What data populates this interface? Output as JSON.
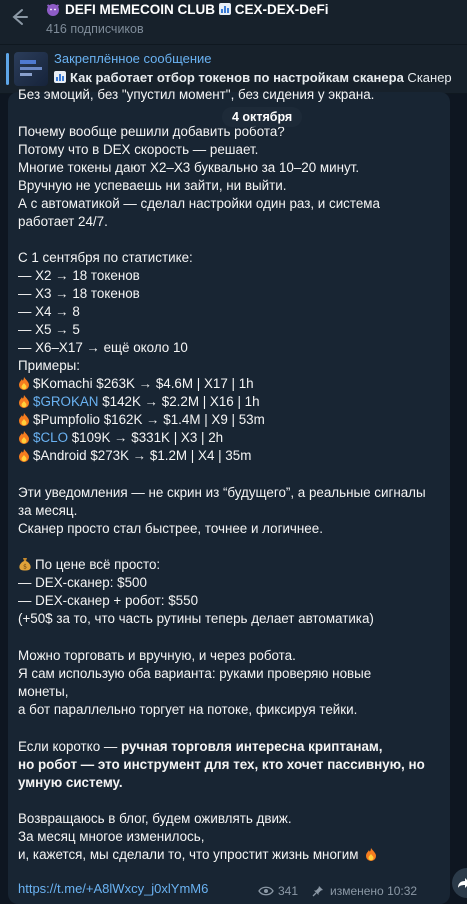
{
  "header": {
    "back_icon": "arrow-left-icon",
    "title_prefix_emoji": "purple-devil-emoji",
    "title": "DEFI MEMECOIN CLUB",
    "title_chart_emoji": "bar-chart-emoji",
    "title_suffix": "CEX-DEX-DeFi",
    "subtitle": "416 подписчиков"
  },
  "pinned": {
    "label": "Закреплённое сообщение",
    "bold_text": "Как работает отбор токенов по настройкам сканера",
    "rest_text": " Сканер"
  },
  "date_pill": "4 октября",
  "message": {
    "line_01": "Без эмоций, без \"упустил момент\", без сидения у экрана.",
    "line_02": "Почему вообще решили добавить робота?",
    "line_03": "Потому что в DEX скорость — решает.",
    "line_04": "Многие токены дают X2–X3 буквально за 10–20 минут.",
    "line_05": "Вручную не успеваешь ни зайти, ни выйти.",
    "line_06": "А с автоматикой — сделал настройки один раз, и система",
    "line_07": "работает 24/7.",
    "line_08": "С 1 сентября по статистике:",
    "line_09": "— X2 → 18 токенов",
    "line_10": "— X3 → 18 токенов",
    "line_11": "— X4 → 8",
    "line_12": "— X5 → 5",
    "line_13": "— X6–X17 → ещё около 10",
    "line_14": "Примеры:",
    "ex_1": "$Komachi $263K → $4.6M | X17 | 1h",
    "ex_2_link": "$GROKAN",
    "ex_2_rest": " $142K → $2.2M | X16 | 1h",
    "ex_3": "$Pumpfolio $162K → $1.4M | X9 | 53m",
    "ex_4_link": "$CLO",
    "ex_4_rest": " $109K → $331K | X3 | 2h",
    "ex_5": "$Android $273K → $1.2M | X4 | 35m",
    "line_15": "Эти уведомления — не скрин из “будущего”, а реальные сигналы",
    "line_16": "за месяц.",
    "line_17": "Сканер просто стал быстрее, точнее и логичнее.",
    "line_18": "По цене всё просто:",
    "line_19": "— DEX-сканер: $500",
    "line_20": "— DEX-сканер + робот: $550",
    "line_21": "(+50$ за то, что часть рутины теперь делает автоматика)",
    "line_22": "Можно торговать и вручную, и через робота.",
    "line_23": "Я сам использую оба варианта: руками проверяю новые",
    "line_24": "монеты,",
    "line_25": "а бот параллельно торгует на потоке, фиксируя тейки.",
    "line_26_plain": "Если коротко — ",
    "line_26_bold": "ручная торговля интересна криптанам,",
    "line_27": "но робот — это инструмент для тех, кто хочет пассивную, но",
    "line_28": "умную систему.",
    "line_29": "Возвращаюсь в блог, будем оживлять движ.",
    "line_30": "За месяц многое изменилось,",
    "line_31": "и, кажется, мы сделали то, что упростит жизнь многим"
  },
  "footer": {
    "link": "https://t.me/+A8lWxcy_j0xlYmM6",
    "views": "341",
    "edited": "изменено 10:32"
  },
  "icons": {
    "fire": "fire-emoji",
    "money_bag": "money-bag-emoji",
    "views": "eye-icon",
    "share": "share-icon"
  },
  "colors": {
    "accent": "#6ab2f2",
    "background": "#0e1621",
    "bubble": "#182533"
  }
}
